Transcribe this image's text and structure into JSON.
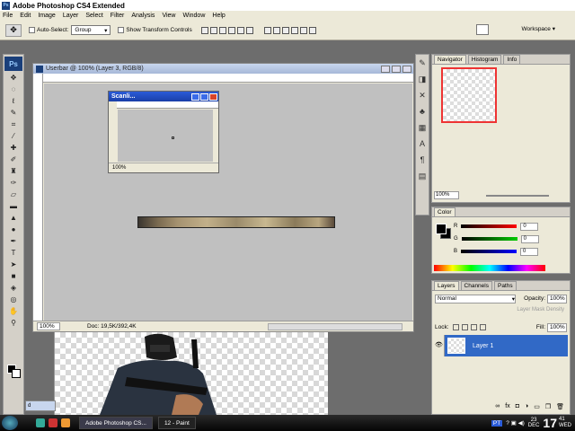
{
  "app": {
    "title": "Adobe Photoshop CS4 Extended",
    "logo_text": "Ps"
  },
  "menu": [
    "File",
    "Edit",
    "Image",
    "Layer",
    "Select",
    "Filter",
    "Analysis",
    "View",
    "Window",
    "Help"
  ],
  "options": {
    "auto_select_label": "Auto-Select:",
    "auto_select_value": "Group",
    "show_transform_label": "Show Transform Controls",
    "workspace_label": "Workspace"
  },
  "document": {
    "title": "Userbar @ 100% (Layer 3, RGB/8)",
    "zoom": "100%",
    "info": "Doc: 19,5K/392,4K"
  },
  "scanlines": {
    "title": "Scanli...",
    "zoom": "100%"
  },
  "minidoc": {
    "title": "d"
  },
  "navigator": {
    "tabs": [
      "Navigator",
      "Histogram",
      "Info"
    ],
    "zoom": "100%"
  },
  "color": {
    "tab": "Color",
    "channels": [
      {
        "label": "R",
        "value": "0",
        "color": "#ff0000"
      },
      {
        "label": "G",
        "value": "0",
        "color": "#00cc00"
      },
      {
        "label": "B",
        "value": "0",
        "color": "#0000ff"
      }
    ]
  },
  "layers": {
    "tabs": [
      "Layers",
      "Channels",
      "Paths"
    ],
    "blend_mode": "Normal",
    "opacity_label": "Opacity:",
    "opacity": "100%",
    "mask_density_label": "Layer Mask Density",
    "lock_label": "Lock:",
    "fill_label": "Fill:",
    "fill": "100%",
    "items": [
      {
        "name": "Layer 1",
        "selected": true
      }
    ]
  },
  "taskbar": {
    "buttons": [
      {
        "label": "Adobe Photoshop CS...",
        "active": true
      },
      {
        "label": "12 - Paint",
        "active": false
      }
    ],
    "lang": "PT",
    "date_day": "23",
    "date_month": "DEC",
    "time": "17",
    "minutes": "41",
    "weekday": "WED"
  }
}
